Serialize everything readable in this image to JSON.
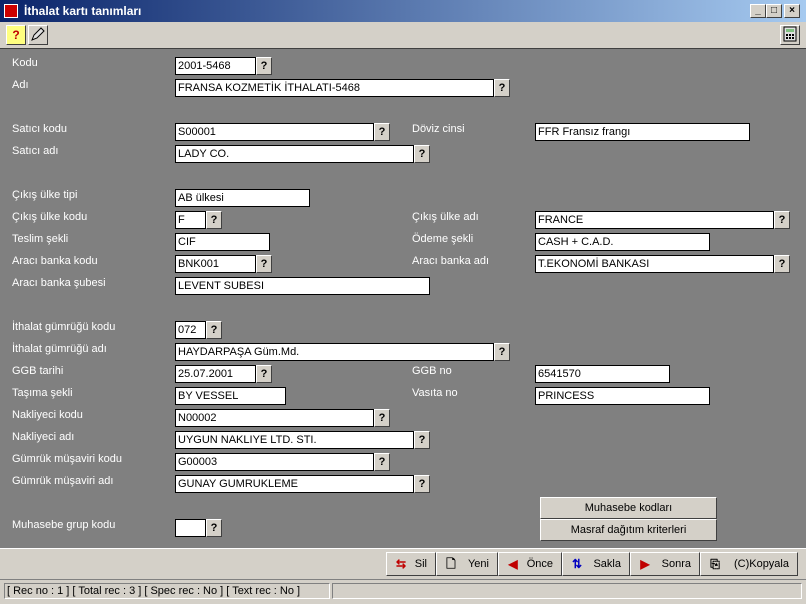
{
  "window": {
    "title": "İthalat kartı tanımları"
  },
  "toolbar": {
    "help_icon": "?"
  },
  "fields": {
    "kodu": {
      "label": "Kodu",
      "value": "2001-5468"
    },
    "adi": {
      "label": "Adı",
      "value": "FRANSA KOZMETİK İTHALATI-5468"
    },
    "satici_kodu": {
      "label": "Satıcı kodu",
      "value": "S00001"
    },
    "doviz_cinsi": {
      "label": "Döviz cinsi",
      "value": "FFR Fransız frangı"
    },
    "satici_adi": {
      "label": "Satıcı adı",
      "value": "LADY CO."
    },
    "cikis_ulke_tipi": {
      "label": "Çıkış ülke tipi",
      "value": "AB ülkesi"
    },
    "cikis_ulke_kodu": {
      "label": "Çıkış ülke kodu",
      "value": "F"
    },
    "cikis_ulke_adi": {
      "label": "Çıkış ülke adı",
      "value": "FRANCE"
    },
    "teslim_sekli": {
      "label": "Teslim şekli",
      "value": "CIF"
    },
    "odeme_sekli": {
      "label": "Ödeme şekli",
      "value": "CASH + C.A.D."
    },
    "araci_banka_kodu": {
      "label": "Aracı banka kodu",
      "value": "BNK001"
    },
    "araci_banka_adi": {
      "label": "Aracı banka adı",
      "value": "T.EKONOMİ BANKASI"
    },
    "araci_banka_subesi": {
      "label": "Aracı banka şubesi",
      "value": "LEVENT SUBESI"
    },
    "ithalat_gumrugu_kodu": {
      "label": "İthalat gümrüğü kodu",
      "value": "072"
    },
    "ithalat_gumrugu_adi": {
      "label": "İthalat gümrüğü adı",
      "value": "HAYDARPAŞA Güm.Md."
    },
    "ggb_tarihi": {
      "label": "GGB tarihi",
      "value": "25.07.2001"
    },
    "ggb_no": {
      "label": "GGB no",
      "value": "6541570"
    },
    "tasima_sekli": {
      "label": "Taşıma şekli",
      "value": "BY VESSEL"
    },
    "vasita_no": {
      "label": "Vasıta no",
      "value": "PRINCESS"
    },
    "nakliyeci_kodu": {
      "label": "Nakliyeci kodu",
      "value": "N00002"
    },
    "nakliyeci_adi": {
      "label": "Nakliyeci adı",
      "value": "UYGUN NAKLIYE LTD. STI."
    },
    "gumruk_musaviri_kodu": {
      "label": "Gümrük müşaviri kodu",
      "value": "G00003"
    },
    "gumruk_musaviri_adi": {
      "label": "Gümrük müşaviri adı",
      "value": "GUNAY GUMRUKLEME"
    },
    "muhasebe_grup_kodu": {
      "label": "Muhasebe grup kodu",
      "value": ""
    }
  },
  "lookup_label": "?",
  "side_buttons": {
    "muhasebe": "Muhasebe kodları",
    "masraf": "Masraf dağıtım kriterleri"
  },
  "actions": {
    "sil": "Sil",
    "yeni": "Yeni",
    "once": "Önce",
    "sakla": "Sakla",
    "sonra": "Sonra",
    "kopyala": "(C)Kopyala"
  },
  "status": {
    "text": "[ Rec no :     1 ] [ Total rec :     3 ] [ Spec rec : No ] [ Text rec : No ]"
  }
}
